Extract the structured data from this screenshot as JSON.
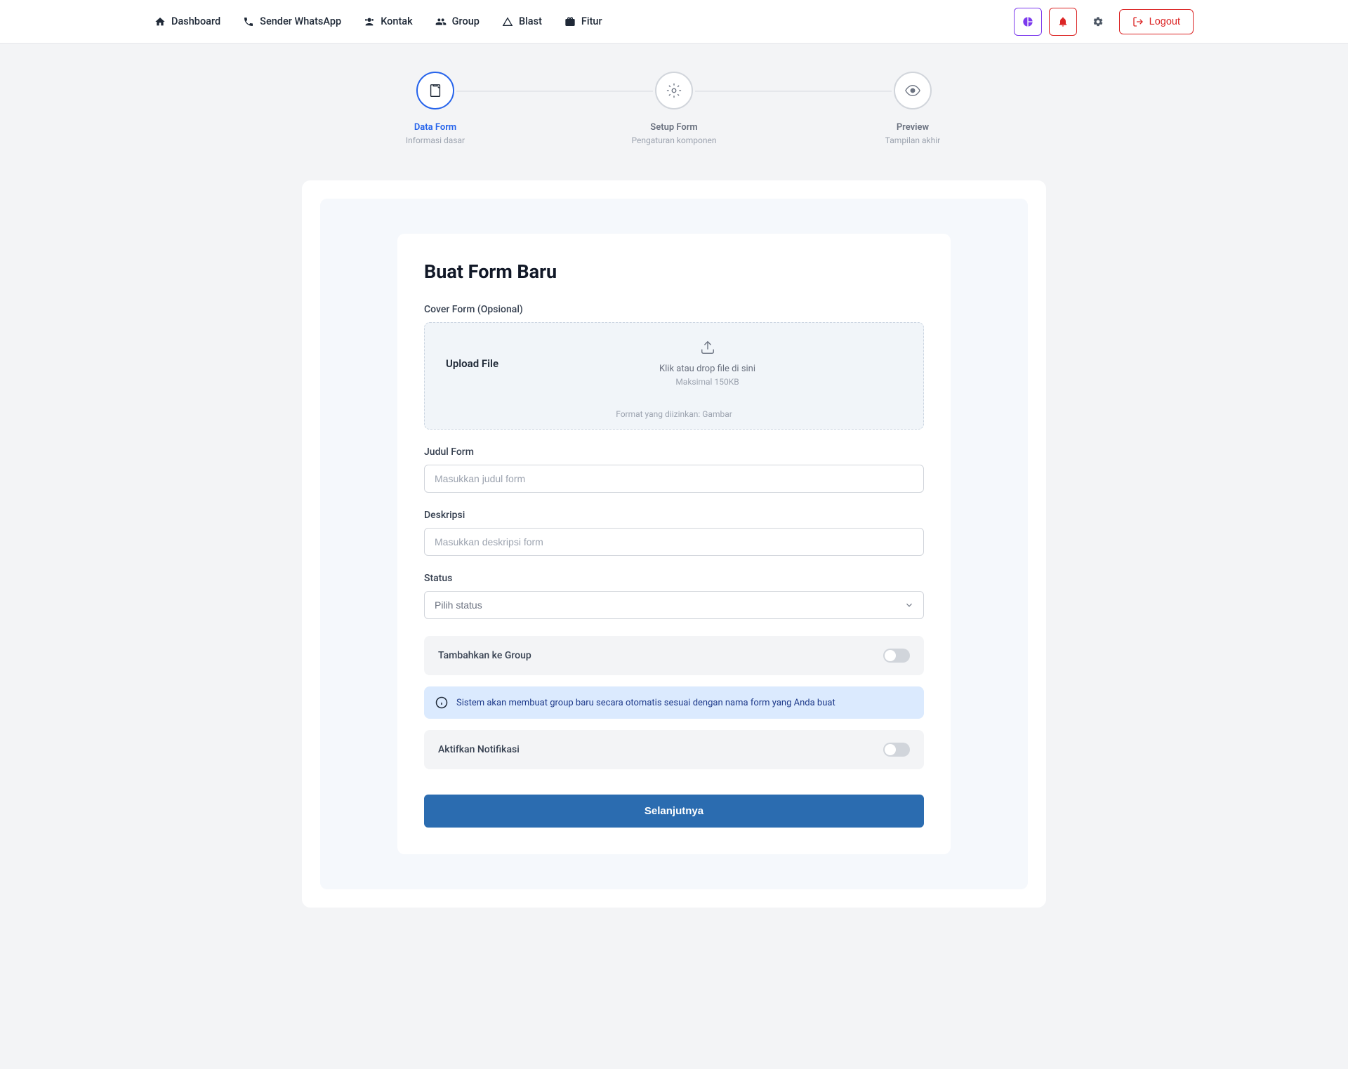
{
  "nav": {
    "items": [
      {
        "label": "Dashboard"
      },
      {
        "label": "Sender WhatsApp"
      },
      {
        "label": "Kontak"
      },
      {
        "label": "Group"
      },
      {
        "label": "Blast"
      },
      {
        "label": "Fitur"
      }
    ],
    "logout": "Logout"
  },
  "stepper": {
    "steps": [
      {
        "title": "Data Form",
        "subtitle": "Informasi dasar"
      },
      {
        "title": "Setup Form",
        "subtitle": "Pengaturan komponen"
      },
      {
        "title": "Preview",
        "subtitle": "Tampilan akhir"
      }
    ]
  },
  "form": {
    "title": "Buat Form Baru",
    "cover": {
      "label": "Cover Form (Opsional)",
      "upload_label": "Upload File",
      "click_text": "Klik atau drop file di sini",
      "max_text": "Maksimal 150KB",
      "format_text": "Format yang diizinkan: Gambar"
    },
    "judul": {
      "label": "Judul Form",
      "placeholder": "Masukkan judul form"
    },
    "deskripsi": {
      "label": "Deskripsi",
      "placeholder": "Masukkan deskripsi form"
    },
    "status": {
      "label": "Status",
      "placeholder": "Pilih status"
    },
    "add_group_label": "Tambahkan ke Group",
    "alert_text": "Sistem akan membuat group baru secara otomatis sesuai dengan nama form yang Anda buat",
    "notif_label": "Aktifkan Notifikasi",
    "submit_label": "Selanjutnya"
  }
}
